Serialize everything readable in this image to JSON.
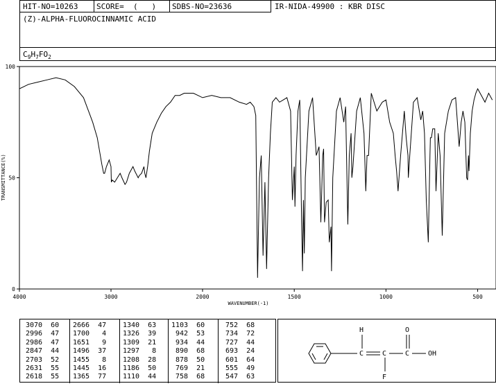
{
  "header": {
    "hit_no": "HIT-NO=10263",
    "score": "SCORE=  (   )",
    "sdbs_no": "SDBS-NO=23636",
    "ir_no": "IR-NIDA-49900 : KBR DISC",
    "compound_name": "(Z)-ALPHA-FLUOROCINNAMIC ACID",
    "formula": "C9H7FO2",
    "formula_parts": [
      "C",
      "9",
      "H",
      "7",
      "FO",
      "2"
    ]
  },
  "chart_data": {
    "type": "line",
    "xlabel": "WAVENUMBER(-1)",
    "ylabel": "TRANSMITTANCE(%)",
    "xlim": [
      4000,
      400
    ],
    "ylim": [
      0,
      100
    ],
    "x_ticks": [
      4000,
      3000,
      2000,
      1500,
      1000,
      500
    ],
    "y_ticks": [
      0,
      50,
      100
    ],
    "grid": false,
    "x": [
      4000,
      3900,
      3800,
      3700,
      3600,
      3500,
      3400,
      3300,
      3200,
      3150,
      3100,
      3080,
      3070,
      3050,
      3020,
      3000,
      2996,
      2986,
      2960,
      2930,
      2900,
      2880,
      2847,
      2830,
      2800,
      2760,
      2740,
      2703,
      2690,
      2666,
      2640,
      2631,
      2618,
      2600,
      2580,
      2550,
      2500,
      2450,
      2400,
      2350,
      2300,
      2250,
      2200,
      2150,
      2100,
      2050,
      2000,
      1950,
      1900,
      1850,
      1800,
      1760,
      1740,
      1720,
      1710,
      1700,
      1690,
      1680,
      1670,
      1660,
      1651,
      1640,
      1630,
      1620,
      1600,
      1580,
      1560,
      1540,
      1520,
      1510,
      1500,
      1496,
      1490,
      1480,
      1470,
      1460,
      1455,
      1450,
      1445,
      1440,
      1420,
      1400,
      1380,
      1365,
      1355,
      1345,
      1340,
      1335,
      1326,
      1315,
      1309,
      1300,
      1297,
      1290,
      1270,
      1250,
      1230,
      1220,
      1208,
      1200,
      1190,
      1186,
      1180,
      1160,
      1140,
      1120,
      1110,
      1103,
      1095,
      1080,
      1050,
      1020,
      1000,
      980,
      960,
      950,
      942,
      934,
      920,
      900,
      890,
      880,
      878,
      870,
      850,
      830,
      810,
      800,
      790,
      780,
      769,
      760,
      758,
      752,
      745,
      734,
      727,
      715,
      705,
      693,
      680,
      660,
      640,
      620,
      601,
      590,
      580,
      570,
      560,
      555,
      550,
      547,
      540,
      530,
      520,
      510,
      500,
      480,
      460,
      440,
      420,
      400
    ],
    "y": [
      90,
      92,
      93,
      94,
      95,
      94,
      91,
      86,
      75,
      68,
      56,
      52,
      52,
      55,
      58,
      55,
      48,
      49,
      48,
      50,
      52,
      50,
      47,
      48,
      52,
      55,
      53,
      50,
      51,
      52,
      55,
      52,
      50,
      55,
      62,
      70,
      75,
      79,
      82,
      84,
      87,
      87,
      88,
      88,
      88,
      87,
      86,
      87,
      86,
      86,
      84,
      83,
      84,
      82,
      78,
      5,
      50,
      60,
      15,
      48,
      9,
      50,
      70,
      84,
      86,
      84,
      85,
      86,
      80,
      40,
      55,
      37,
      60,
      80,
      85,
      30,
      8,
      40,
      16,
      50,
      80,
      86,
      60,
      64,
      30,
      60,
      63,
      30,
      39,
      40,
      21,
      28,
      8,
      50,
      80,
      86,
      75,
      82,
      29,
      60,
      70,
      50,
      55,
      80,
      86,
      70,
      44,
      60,
      60,
      88,
      80,
      84,
      85,
      75,
      70,
      60,
      53,
      44,
      60,
      80,
      68,
      60,
      50,
      60,
      84,
      86,
      76,
      80,
      70,
      40,
      21,
      60,
      68,
      68,
      72,
      72,
      44,
      70,
      60,
      24,
      70,
      80,
      85,
      86,
      64,
      75,
      80,
      75,
      50,
      49,
      60,
      53,
      70,
      80,
      85,
      88,
      90,
      87,
      84,
      88,
      85
    ]
  },
  "peak_table": {
    "columns": [
      [
        "3070  60",
        "2996  47",
        "2986  47",
        "2847  44",
        "2703  52",
        "2631  55",
        "2618  55"
      ],
      [
        "2666  47",
        "1700   4",
        "1651   9",
        "1496  37",
        "1455   8",
        "1445  16",
        "1365  77"
      ],
      [
        "1340  63",
        "1326  39",
        "1309  21",
        "1297   8",
        "1208  28",
        "1186  50",
        "1110  44"
      ],
      [
        "1103  60",
        " 942  53",
        " 934  44",
        " 890  68",
        " 878  50",
        " 769  21",
        " 758  68"
      ],
      [
        " 752  68",
        " 734  72",
        " 727  44",
        " 693  24",
        " 601  64",
        " 555  49",
        " 547  63"
      ]
    ]
  },
  "structure": {
    "atoms": {
      "h": "H",
      "o": "O",
      "c1": "C",
      "c2": "C",
      "c3": "C",
      "oh": "OH",
      "f": "F"
    }
  }
}
